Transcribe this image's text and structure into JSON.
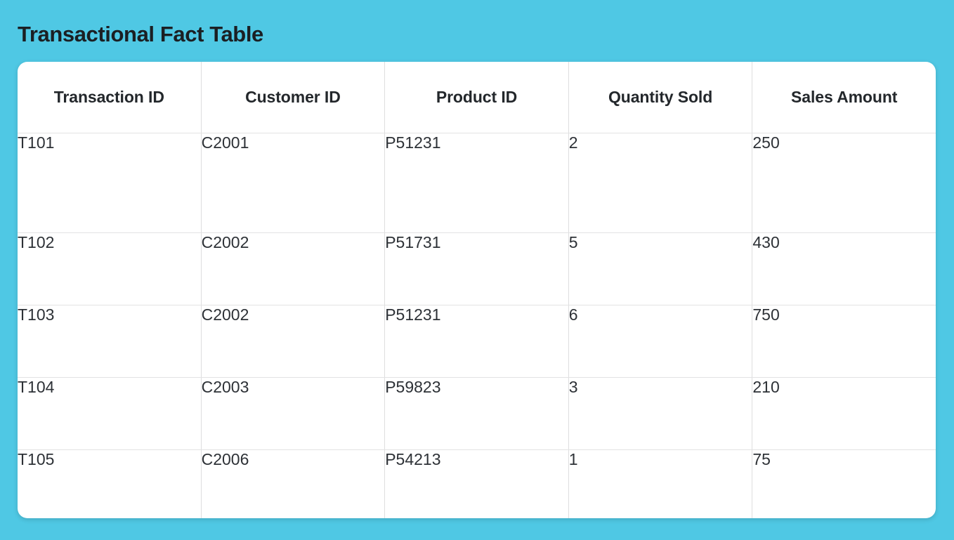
{
  "page": {
    "title": "Transactional Fact Table",
    "background_color": "#4fc8e4",
    "card_color": "#ffffff",
    "title_color": "#1b1f23",
    "border_color": "#dededf"
  },
  "table": {
    "columns": [
      {
        "key": "transaction_id",
        "label": "Transaction ID"
      },
      {
        "key": "customer_id",
        "label": "Customer ID"
      },
      {
        "key": "product_id",
        "label": "Product ID"
      },
      {
        "key": "quantity_sold",
        "label": "Quantity Sold"
      },
      {
        "key": "sales_amount",
        "label": "Sales Amount"
      }
    ],
    "rows": [
      {
        "transaction_id": "T101",
        "customer_id": "C2001",
        "product_id": "P51231",
        "quantity_sold": "2",
        "sales_amount": "250"
      },
      {
        "transaction_id": "T102",
        "customer_id": "C2002",
        "product_id": "P51731",
        "quantity_sold": "5",
        "sales_amount": "430"
      },
      {
        "transaction_id": "T103",
        "customer_id": "C2002",
        "product_id": "P51231",
        "quantity_sold": "6",
        "sales_amount": "750"
      },
      {
        "transaction_id": "T104",
        "customer_id": "C2003",
        "product_id": "P59823",
        "quantity_sold": "3",
        "sales_amount": "210"
      },
      {
        "transaction_id": "T105",
        "customer_id": "C2006",
        "product_id": "P54213",
        "quantity_sold": "1",
        "sales_amount": "75"
      }
    ]
  }
}
